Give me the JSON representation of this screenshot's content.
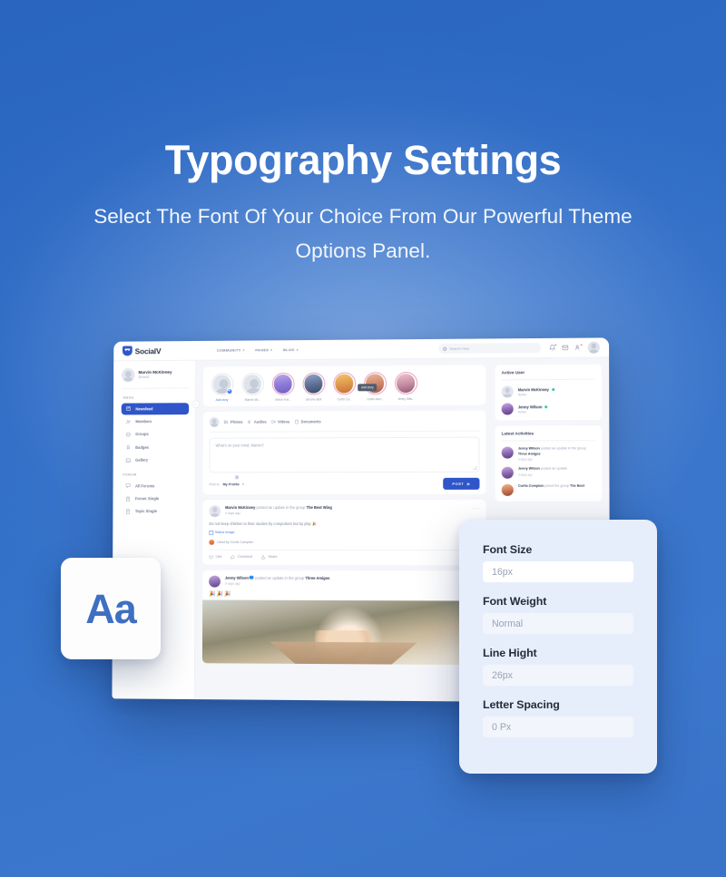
{
  "hero": {
    "title": "Typography Settings",
    "subtitle": "Select The Font Of Your Choice From Our Powerful Theme Options Panel."
  },
  "font_card": {
    "sample": "Aa"
  },
  "typography_panel": {
    "fields": [
      {
        "label": "Font Size",
        "value": "16px"
      },
      {
        "label": "Font Weight",
        "value": "Normal"
      },
      {
        "label": "Line Hight",
        "value": "26px"
      },
      {
        "label": "Letter Spacing",
        "value": "0 Px"
      }
    ]
  },
  "mockup": {
    "brand": "SocialV",
    "nav": [
      {
        "label": "COMMUNITY"
      },
      {
        "label": "PAGES"
      },
      {
        "label": "BLOG"
      }
    ],
    "search_placeholder": "Search Here",
    "profile": {
      "name": "Marvin McKinney",
      "handle": "@david"
    },
    "sidebar": {
      "menu_label": "MENU",
      "menu_items": [
        {
          "label": "Newsfeed",
          "active": true
        },
        {
          "label": "Members",
          "active": false
        },
        {
          "label": "Groups",
          "active": false
        },
        {
          "label": "Badges",
          "active": false
        },
        {
          "label": "Gallery",
          "active": false
        }
      ],
      "forum_label": "FORUM",
      "forum_items": [
        {
          "label": "All Forums"
        },
        {
          "label": "Forum Single"
        },
        {
          "label": "Topic Single"
        }
      ]
    },
    "stories": [
      {
        "name": "Add story",
        "link": true
      },
      {
        "name": "Marvin Mc..",
        "link": false
      },
      {
        "name": "Aaron Iron..",
        "link": false
      },
      {
        "name": "Jerome Bell",
        "link": false
      },
      {
        "name": "Curtis Ca..",
        "link": false
      },
      {
        "name": "Leslie Alex..",
        "link": false
      },
      {
        "name": "Jenny Wils..",
        "link": false
      }
    ],
    "story_tooltip": "Add story",
    "composer": {
      "options": [
        "Photos",
        "Audios",
        "Videos",
        "Documents"
      ],
      "placeholder": "What's on your mind, Marvin?",
      "post_to_label": "Post to",
      "post_to_value": "My Profile",
      "post_button": "POST"
    },
    "posts": [
      {
        "author": "Marvin McKinney",
        "action": "posted an update in the group",
        "group": "The Best Wing",
        "time": "4 days ago",
        "body": "Do not keep children to their studies by compulsion but by play 🎉",
        "image_alt": "Status image",
        "liked_by": "Liked by Curtis Campher",
        "actions": [
          "Like",
          "Comment",
          "Share"
        ]
      },
      {
        "author": "Jenny Wilson",
        "action": "posted an update in the group",
        "group": "Three Amigos",
        "time": "4 days ago",
        "emojis": "🎉🎉🎉"
      }
    ],
    "active_user": {
      "title": "Active User",
      "users": [
        {
          "name": "Marvin McKinney",
          "status": "Active"
        },
        {
          "name": "Jenny Wilson",
          "status": "Active"
        }
      ]
    },
    "latest_activities": {
      "title": "Latest Activities",
      "items": [
        {
          "author": "Jenny Wilson",
          "action": "posted an update in the group",
          "group": "Three Amigos",
          "time": "4 days ago"
        },
        {
          "author": "Jenny Wilson",
          "action": "posted an update",
          "group": "",
          "time": "4 days ago"
        },
        {
          "author": "Curtis Compton",
          "action": "joined the group",
          "group": "The Best",
          "time": ""
        }
      ]
    }
  },
  "colors": {
    "background_top": "#2a66c0",
    "background_bottom": "#3b77cc",
    "accent": "#2f55c9",
    "panel_bg": "#e7eefb",
    "aa_text": "#3f6fc0"
  }
}
